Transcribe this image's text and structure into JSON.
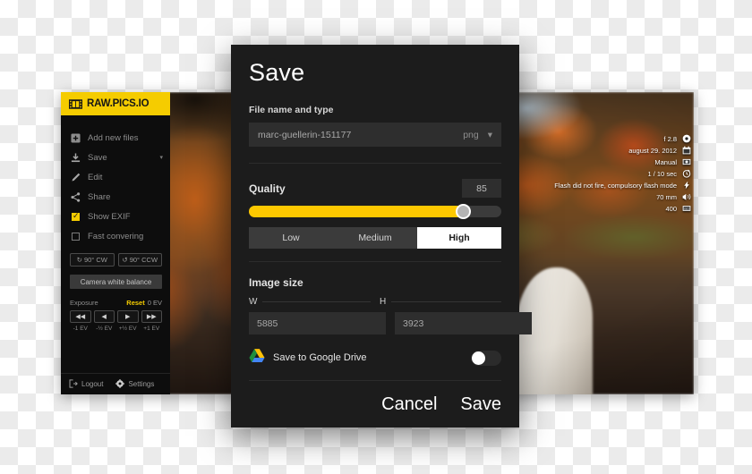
{
  "app": {
    "logo_text": "RAW.PICS.IO",
    "logo_icon": "film-strip-icon",
    "brand_yellow": "#f5cc00",
    "menu": [
      {
        "label": "Add new files",
        "icon": "add-files-icon",
        "type": "plain"
      },
      {
        "label": "Save",
        "icon": "download-icon",
        "type": "caret",
        "caret": "▾"
      },
      {
        "label": "Edit",
        "icon": "pencil-icon",
        "type": "plain"
      },
      {
        "label": "Share",
        "icon": "share-icon",
        "type": "plain"
      },
      {
        "label": "Show EXIF",
        "icon": "checkbox-checked-icon",
        "type": "checkbox",
        "checked": true
      },
      {
        "label": "Fast convering",
        "icon": "checkbox-icon",
        "type": "checkbox",
        "checked": false
      }
    ],
    "rotate": [
      {
        "label": "90° CW",
        "icon": "rotate-cw-icon",
        "glyph": "↻"
      },
      {
        "label": "90° CCW",
        "icon": "rotate-ccw-icon",
        "glyph": "↺"
      }
    ],
    "white_balance_label": "Camera white balance",
    "exposure": {
      "label": "Exposure",
      "reset_label": "Reset",
      "value": "0 EV",
      "buttons": [
        {
          "glyph": "◀◀",
          "label": "-1 EV"
        },
        {
          "glyph": "◀",
          "label": "-½ EV"
        },
        {
          "glyph": "▶",
          "label": "+½ EV"
        },
        {
          "glyph": "▶▶",
          "label": "+1 EV"
        }
      ]
    },
    "footer": [
      {
        "label": "Logout",
        "icon": "logout-icon"
      },
      {
        "label": "Settings",
        "icon": "gear-icon"
      }
    ]
  },
  "exif": [
    {
      "value": "f 2.8",
      "icon": "aperture-icon"
    },
    {
      "value": "august 29. 2012",
      "icon": "calendar-icon"
    },
    {
      "value": "Manual",
      "icon": "exposure-mode-icon"
    },
    {
      "value": "1 / 10 sec",
      "icon": "shutter-speed-icon"
    },
    {
      "value": "Flash did not fire, compulsory flash mode",
      "icon": "flash-icon"
    },
    {
      "value": "70 mm",
      "icon": "lens-icon"
    },
    {
      "value": "400",
      "icon": "iso-icon"
    }
  ],
  "dialog": {
    "title": "Save",
    "filename_section_label": "File name and type",
    "filename_value": "marc-guellerin-151177",
    "filename_placeholder": "File name",
    "extension": "png",
    "extension_caret": "▾",
    "quality_label": "Quality",
    "quality_value": "85",
    "quality_percent": 85,
    "slider_color": "#fdc800",
    "quality_presets": [
      {
        "label": "Low",
        "active": false
      },
      {
        "label": "Medium",
        "active": false
      },
      {
        "label": "High",
        "active": true
      }
    ],
    "image_size_label": "Image size",
    "width_label": "W",
    "width_value": "5885",
    "height_label": "H",
    "height_value": "3923",
    "gdrive_label": "Save to Google Drive",
    "gdrive_icon": "google-drive-icon",
    "gdrive_enabled": false,
    "cancel_label": "Cancel",
    "save_label": "Save"
  }
}
